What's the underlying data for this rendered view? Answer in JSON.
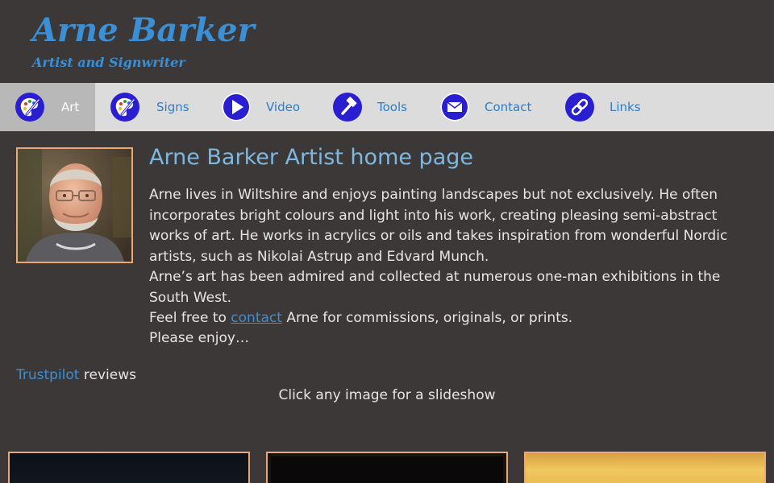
{
  "header": {
    "title": "Arne Barker",
    "subtitle": "Artist and Signwriter"
  },
  "nav": {
    "items": [
      {
        "label": "Art",
        "icon": "palette-icon",
        "active": true
      },
      {
        "label": "Signs",
        "icon": "palette-icon",
        "active": false
      },
      {
        "label": "Video",
        "icon": "play-icon",
        "active": false
      },
      {
        "label": "Tools",
        "icon": "hammer-icon",
        "active": false
      },
      {
        "label": "Contact",
        "icon": "envelope-icon",
        "active": false
      },
      {
        "label": "Links",
        "icon": "link-icon",
        "active": false
      }
    ]
  },
  "main": {
    "heading": "Arne Barker Artist home page",
    "paragraph1": "Arne lives in Wiltshire and enjoys painting landscapes but not exclusively. He often incorporates bright colours and light into his work, creating pleasing semi-abstract works of art. He works in acrylics or oils and takes inspiration from wonderful Nordic artists, such as Nikolai Astrup and Edvard Munch.",
    "paragraph2": "Arne’s art has been admired and collected at numerous one-man exhibitions in the South West.",
    "paragraph3_before": "Feel free to ",
    "paragraph3_link": "contact",
    "paragraph3_after": " Arne for commissions, originals, or prints.",
    "paragraph4": "Please enjoy…",
    "reviews_link": "Trustpilot",
    "reviews_text": " reviews",
    "slideshow_note": "Click any image for a slideshow"
  },
  "colors": {
    "background": "#3c3838",
    "accent": "#3a8fd6",
    "nav_background": "#dcdcdc",
    "nav_active": "#b8b8b8",
    "frame": "#e8a878"
  }
}
